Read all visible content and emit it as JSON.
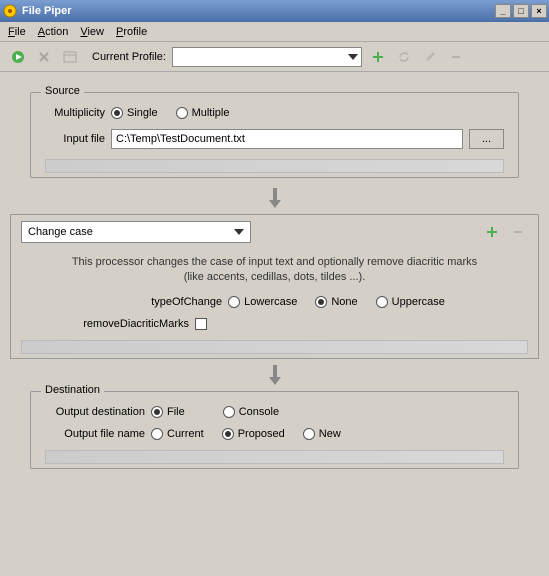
{
  "window": {
    "title": "File Piper"
  },
  "menu": {
    "file": "File",
    "action": "Action",
    "view": "View",
    "profile": "Profile"
  },
  "toolbar": {
    "profile_label": "Current Profile:",
    "profile_value": ""
  },
  "source": {
    "legend": "Source",
    "multiplicity_label": "Multiplicity",
    "single": "Single",
    "multiple": "Multiple",
    "input_file_label": "Input file",
    "input_file_value": "C:\\Temp\\TestDocument.txt",
    "browse": "..."
  },
  "processor": {
    "selected": "Change case",
    "description": "This processor changes the case of input text and optionally remove diacritic marks (like accents, cedillas, dots, tildes ...).",
    "typeOfChange_label": "typeOfChange",
    "lowercase": "Lowercase",
    "none": "None",
    "uppercase": "Uppercase",
    "removeDiacritic_label": "removeDiacriticMarks"
  },
  "destination": {
    "legend": "Destination",
    "output_dest_label": "Output destination",
    "file": "File",
    "console": "Console",
    "output_name_label": "Output file name",
    "current": "Current",
    "proposed": "Proposed",
    "new": "New"
  }
}
